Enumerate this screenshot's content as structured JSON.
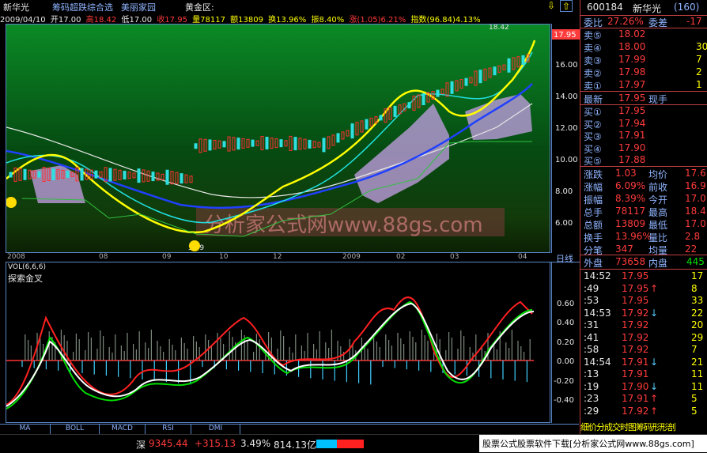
{
  "header": {
    "stock_name": "新华光",
    "indicators": [
      "筹码超跌综合选",
      "美丽家园"
    ],
    "field_label": "黄金区:",
    "down_arrow_glyph": "⇩",
    "up_arrow_glyph": "⇧"
  },
  "info_bar": {
    "date": "2009/04/10",
    "open": "开17.00",
    "high": "高18.42",
    "low": "低17.00",
    "close": "收17.95",
    "volume": "量78117",
    "amount": "额13809",
    "turnover": "换13.96%",
    "amplitude": "振8.40%",
    "rise": "涨(1.05)6.21%",
    "index": "指数(96.84)4.13%"
  },
  "main_chart": {
    "price_ticks": [
      "16.00",
      "14.00",
      "12.00",
      "10.00",
      "8.00",
      "6.00"
    ],
    "current_price_tag": "17.95",
    "high_marker": "18.42",
    "low_marker": "5.09",
    "date_labels": [
      "2008",
      "08",
      "09",
      "10",
      "12",
      "2009",
      "02",
      "03",
      "04"
    ],
    "period_label": "日线",
    "watermark": "分析家公式网www.88gs.com"
  },
  "vol_panel": {
    "params": "VOL(6,6,6)",
    "title": "探索金叉",
    "ticks": [
      "0.60",
      "0.40",
      "0.20",
      "0.00",
      "-0.20",
      "-0.40"
    ]
  },
  "bottom_tabs": [
    "MA",
    "BOLL",
    "MACD",
    "RSI",
    "DMI"
  ],
  "status_bar": {
    "market": "深",
    "index_value": "9345.44",
    "change": "+315.13",
    "change_pct": "3.49%",
    "amount": "814.13亿",
    "banner": "股票公式股票软件下载[分析家公式网www.88gs.com]"
  },
  "right_panel": {
    "code": "600184",
    "name": "新华光",
    "count": "(160)",
    "weibi_label": "委比",
    "weibi_value": "27.26%",
    "weicha_label": "委差",
    "weicha_value": "-17",
    "asks": [
      {
        "label": "卖⑤",
        "price": "18.02",
        "vol": ""
      },
      {
        "label": "卖④",
        "price": "18.00",
        "vol": "30"
      },
      {
        "label": "卖③",
        "price": "17.99",
        "vol": "7"
      },
      {
        "label": "卖②",
        "price": "17.98",
        "vol": "2"
      },
      {
        "label": "卖①",
        "price": "17.97",
        "vol": "1"
      }
    ],
    "latest_label": "最新",
    "latest_value": "17.95",
    "xianshou_label": "现手",
    "bids": [
      {
        "label": "买①",
        "price": "17.95"
      },
      {
        "label": "买②",
        "price": "17.94"
      },
      {
        "label": "买③",
        "price": "17.91"
      },
      {
        "label": "买④",
        "price": "17.90"
      },
      {
        "label": "买⑤",
        "price": "17.88"
      }
    ],
    "stats": [
      {
        "l1": "涨跌",
        "v1": "1.03",
        "l2": "均价",
        "v2": "17.6"
      },
      {
        "l1": "涨幅",
        "v1": "6.09%",
        "l2": "前收",
        "v2": "16.9"
      },
      {
        "l1": "振幅",
        "v1": "8.39%",
        "l2": "今开",
        "v2": "17.0"
      },
      {
        "l1": "总手",
        "v1": "78117",
        "l2": "最高",
        "v2": "18.4"
      },
      {
        "l1": "总额",
        "v1": "13809",
        "l2": "最低",
        "v2": "17.0"
      },
      {
        "l1": "换手",
        "v1": "13.96%",
        "l2": "量比",
        "v2": "2.8"
      },
      {
        "l1": "分笔",
        "v1": "347",
        "l2": "均量",
        "v2": "22"
      }
    ],
    "outer_label": "外盘",
    "outer_value": "73658",
    "inner_label": "内盘",
    "inner_value": "445",
    "ticks": [
      {
        "time": "14:52",
        "price": "17.95",
        "arrow": "",
        "vol": "17"
      },
      {
        "time": ":49",
        "price": "17.95",
        "arrow": "↑",
        "vol": "8"
      },
      {
        "time": ":53",
        "price": "17.95",
        "arrow": "",
        "vol": "33"
      },
      {
        "time": "14:53",
        "price": "17.92",
        "arrow": "↓",
        "vol": "22"
      },
      {
        "time": ":31",
        "price": "17.92",
        "arrow": "",
        "vol": "20"
      },
      {
        "time": ":41",
        "price": "17.92",
        "arrow": "",
        "vol": "29"
      },
      {
        "time": ":58",
        "price": "17.92",
        "arrow": "",
        "vol": "7"
      },
      {
        "time": "14:54",
        "price": "17.91",
        "arrow": "↓",
        "vol": "21"
      },
      {
        "time": ":13",
        "price": "17.91",
        "arrow": "",
        "vol": "11"
      },
      {
        "time": ":19",
        "price": "17.90",
        "arrow": "↓",
        "vol": "11"
      },
      {
        "time": ":23",
        "price": "17.91",
        "arrow": "↑",
        "vol": "5"
      },
      {
        "time": ":29",
        "price": "17.92",
        "arrow": "↑",
        "vol": "5"
      }
    ],
    "bottom_buttons": "细价分成交时图筹码形形剖"
  },
  "colors": {
    "accent_blue": "#5a86c8",
    "up_red": "#ff3b3b",
    "down_green": "#00e000",
    "yellow": "#ffff00",
    "purple_band": "#c8a0e8"
  }
}
